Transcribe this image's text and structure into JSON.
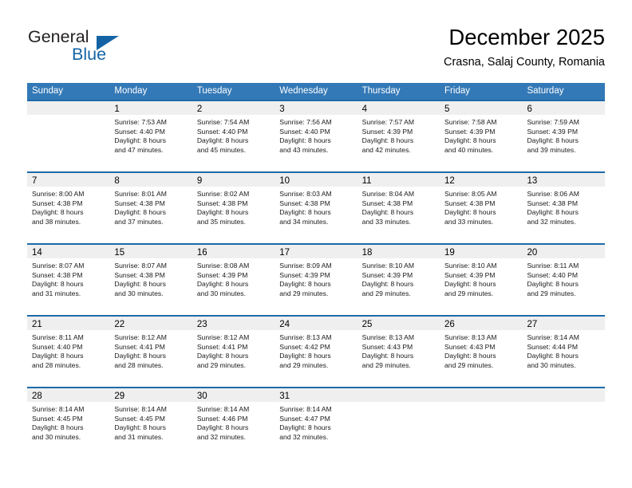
{
  "brand": {
    "name_part1": "General",
    "name_part2": "Blue"
  },
  "header": {
    "title": "December 2025",
    "subtitle": "Crasna, Salaj County, Romania"
  },
  "colors": {
    "header_blue": "#3479b7",
    "separator_blue": "#1f6aa8",
    "daynum_band": "#efefef",
    "brand_blue": "#1464a5"
  },
  "weekdays": [
    "Sunday",
    "Monday",
    "Tuesday",
    "Wednesday",
    "Thursday",
    "Friday",
    "Saturday"
  ],
  "weeks": [
    [
      {
        "day": "",
        "sunrise": "",
        "sunset": "",
        "daylight_line1": "",
        "daylight_line2": ""
      },
      {
        "day": "1",
        "sunrise": "Sunrise: 7:53 AM",
        "sunset": "Sunset: 4:40 PM",
        "daylight_line1": "Daylight: 8 hours",
        "daylight_line2": "and 47 minutes."
      },
      {
        "day": "2",
        "sunrise": "Sunrise: 7:54 AM",
        "sunset": "Sunset: 4:40 PM",
        "daylight_line1": "Daylight: 8 hours",
        "daylight_line2": "and 45 minutes."
      },
      {
        "day": "3",
        "sunrise": "Sunrise: 7:56 AM",
        "sunset": "Sunset: 4:40 PM",
        "daylight_line1": "Daylight: 8 hours",
        "daylight_line2": "and 43 minutes."
      },
      {
        "day": "4",
        "sunrise": "Sunrise: 7:57 AM",
        "sunset": "Sunset: 4:39 PM",
        "daylight_line1": "Daylight: 8 hours",
        "daylight_line2": "and 42 minutes."
      },
      {
        "day": "5",
        "sunrise": "Sunrise: 7:58 AM",
        "sunset": "Sunset: 4:39 PM",
        "daylight_line1": "Daylight: 8 hours",
        "daylight_line2": "and 40 minutes."
      },
      {
        "day": "6",
        "sunrise": "Sunrise: 7:59 AM",
        "sunset": "Sunset: 4:39 PM",
        "daylight_line1": "Daylight: 8 hours",
        "daylight_line2": "and 39 minutes."
      }
    ],
    [
      {
        "day": "7",
        "sunrise": "Sunrise: 8:00 AM",
        "sunset": "Sunset: 4:38 PM",
        "daylight_line1": "Daylight: 8 hours",
        "daylight_line2": "and 38 minutes."
      },
      {
        "day": "8",
        "sunrise": "Sunrise: 8:01 AM",
        "sunset": "Sunset: 4:38 PM",
        "daylight_line1": "Daylight: 8 hours",
        "daylight_line2": "and 37 minutes."
      },
      {
        "day": "9",
        "sunrise": "Sunrise: 8:02 AM",
        "sunset": "Sunset: 4:38 PM",
        "daylight_line1": "Daylight: 8 hours",
        "daylight_line2": "and 35 minutes."
      },
      {
        "day": "10",
        "sunrise": "Sunrise: 8:03 AM",
        "sunset": "Sunset: 4:38 PM",
        "daylight_line1": "Daylight: 8 hours",
        "daylight_line2": "and 34 minutes."
      },
      {
        "day": "11",
        "sunrise": "Sunrise: 8:04 AM",
        "sunset": "Sunset: 4:38 PM",
        "daylight_line1": "Daylight: 8 hours",
        "daylight_line2": "and 33 minutes."
      },
      {
        "day": "12",
        "sunrise": "Sunrise: 8:05 AM",
        "sunset": "Sunset: 4:38 PM",
        "daylight_line1": "Daylight: 8 hours",
        "daylight_line2": "and 33 minutes."
      },
      {
        "day": "13",
        "sunrise": "Sunrise: 8:06 AM",
        "sunset": "Sunset: 4:38 PM",
        "daylight_line1": "Daylight: 8 hours",
        "daylight_line2": "and 32 minutes."
      }
    ],
    [
      {
        "day": "14",
        "sunrise": "Sunrise: 8:07 AM",
        "sunset": "Sunset: 4:38 PM",
        "daylight_line1": "Daylight: 8 hours",
        "daylight_line2": "and 31 minutes."
      },
      {
        "day": "15",
        "sunrise": "Sunrise: 8:07 AM",
        "sunset": "Sunset: 4:38 PM",
        "daylight_line1": "Daylight: 8 hours",
        "daylight_line2": "and 30 minutes."
      },
      {
        "day": "16",
        "sunrise": "Sunrise: 8:08 AM",
        "sunset": "Sunset: 4:39 PM",
        "daylight_line1": "Daylight: 8 hours",
        "daylight_line2": "and 30 minutes."
      },
      {
        "day": "17",
        "sunrise": "Sunrise: 8:09 AM",
        "sunset": "Sunset: 4:39 PM",
        "daylight_line1": "Daylight: 8 hours",
        "daylight_line2": "and 29 minutes."
      },
      {
        "day": "18",
        "sunrise": "Sunrise: 8:10 AM",
        "sunset": "Sunset: 4:39 PM",
        "daylight_line1": "Daylight: 8 hours",
        "daylight_line2": "and 29 minutes."
      },
      {
        "day": "19",
        "sunrise": "Sunrise: 8:10 AM",
        "sunset": "Sunset: 4:39 PM",
        "daylight_line1": "Daylight: 8 hours",
        "daylight_line2": "and 29 minutes."
      },
      {
        "day": "20",
        "sunrise": "Sunrise: 8:11 AM",
        "sunset": "Sunset: 4:40 PM",
        "daylight_line1": "Daylight: 8 hours",
        "daylight_line2": "and 29 minutes."
      }
    ],
    [
      {
        "day": "21",
        "sunrise": "Sunrise: 8:11 AM",
        "sunset": "Sunset: 4:40 PM",
        "daylight_line1": "Daylight: 8 hours",
        "daylight_line2": "and 28 minutes."
      },
      {
        "day": "22",
        "sunrise": "Sunrise: 8:12 AM",
        "sunset": "Sunset: 4:41 PM",
        "daylight_line1": "Daylight: 8 hours",
        "daylight_line2": "and 28 minutes."
      },
      {
        "day": "23",
        "sunrise": "Sunrise: 8:12 AM",
        "sunset": "Sunset: 4:41 PM",
        "daylight_line1": "Daylight: 8 hours",
        "daylight_line2": "and 29 minutes."
      },
      {
        "day": "24",
        "sunrise": "Sunrise: 8:13 AM",
        "sunset": "Sunset: 4:42 PM",
        "daylight_line1": "Daylight: 8 hours",
        "daylight_line2": "and 29 minutes."
      },
      {
        "day": "25",
        "sunrise": "Sunrise: 8:13 AM",
        "sunset": "Sunset: 4:43 PM",
        "daylight_line1": "Daylight: 8 hours",
        "daylight_line2": "and 29 minutes."
      },
      {
        "day": "26",
        "sunrise": "Sunrise: 8:13 AM",
        "sunset": "Sunset: 4:43 PM",
        "daylight_line1": "Daylight: 8 hours",
        "daylight_line2": "and 29 minutes."
      },
      {
        "day": "27",
        "sunrise": "Sunrise: 8:14 AM",
        "sunset": "Sunset: 4:44 PM",
        "daylight_line1": "Daylight: 8 hours",
        "daylight_line2": "and 30 minutes."
      }
    ],
    [
      {
        "day": "28",
        "sunrise": "Sunrise: 8:14 AM",
        "sunset": "Sunset: 4:45 PM",
        "daylight_line1": "Daylight: 8 hours",
        "daylight_line2": "and 30 minutes."
      },
      {
        "day": "29",
        "sunrise": "Sunrise: 8:14 AM",
        "sunset": "Sunset: 4:45 PM",
        "daylight_line1": "Daylight: 8 hours",
        "daylight_line2": "and 31 minutes."
      },
      {
        "day": "30",
        "sunrise": "Sunrise: 8:14 AM",
        "sunset": "Sunset: 4:46 PM",
        "daylight_line1": "Daylight: 8 hours",
        "daylight_line2": "and 32 minutes."
      },
      {
        "day": "31",
        "sunrise": "Sunrise: 8:14 AM",
        "sunset": "Sunset: 4:47 PM",
        "daylight_line1": "Daylight: 8 hours",
        "daylight_line2": "and 32 minutes."
      },
      {
        "day": "",
        "sunrise": "",
        "sunset": "",
        "daylight_line1": "",
        "daylight_line2": ""
      },
      {
        "day": "",
        "sunrise": "",
        "sunset": "",
        "daylight_line1": "",
        "daylight_line2": ""
      },
      {
        "day": "",
        "sunrise": "",
        "sunset": "",
        "daylight_line1": "",
        "daylight_line2": ""
      }
    ]
  ]
}
